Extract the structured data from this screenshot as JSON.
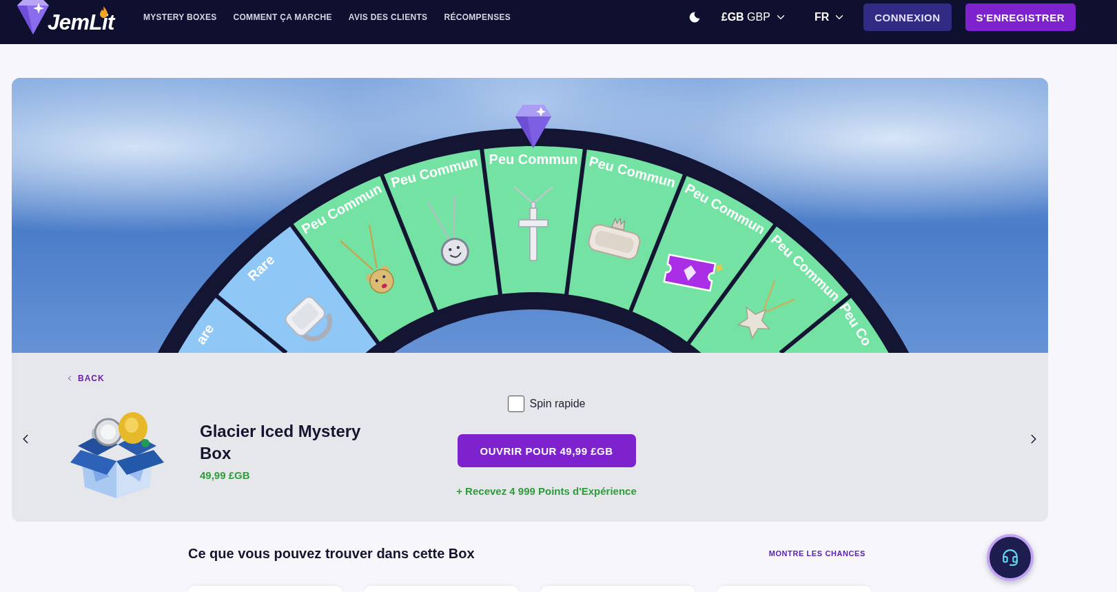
{
  "header": {
    "logo": "JemLit",
    "nav": [
      {
        "label": "MYSTERY BOXES"
      },
      {
        "label": "COMMENT ÇA MARCHE"
      },
      {
        "label": "AVIS DES CLIENTS"
      },
      {
        "label": "RÉCOMPENSES"
      }
    ],
    "currency": "**£GB** GBP",
    "language": "FR",
    "buttons": [
      {
        "label": "CONNEXION",
        "kind": "secondary"
      },
      {
        "label": "S'ENREGISTRER",
        "kind": "primary"
      }
    ]
  },
  "wheel": {
    "segments": [
      {
        "label": "are",
        "color": "#8fc7f6"
      },
      {
        "label": "Rare",
        "color": "#8fc7f6"
      },
      {
        "label": "Peu Commun",
        "color": "#74e2a3"
      },
      {
        "label": "Peu Commun",
        "color": "#74e2a3"
      },
      {
        "label": "Peu Commun",
        "color": "#74e2a3"
      },
      {
        "label": "Peu Commun",
        "color": "#74e2a3"
      },
      {
        "label": "Peu Commun",
        "color": "#74e2a3"
      },
      {
        "label": "Peu Commun",
        "color": "#74e2a3"
      },
      {
        "label": "Peu Co",
        "color": "#74e2a3"
      }
    ]
  },
  "box_panel": {
    "back": "BACK",
    "title": "Glacier Iced Mystery Box",
    "price": "49,99 £GB",
    "fast_spin": {
      "label": "Spin rapide",
      "checked": false
    },
    "open_button": "OUVRIR POUR 49,99 £GB",
    "xp_reward": "+ Recevez 4 999 Points d'Expérience"
  },
  "contents": {
    "title": "Ce que vous pouvez trouver dans cette Box",
    "odds_link": "MONTRE LES CHANCES"
  }
}
